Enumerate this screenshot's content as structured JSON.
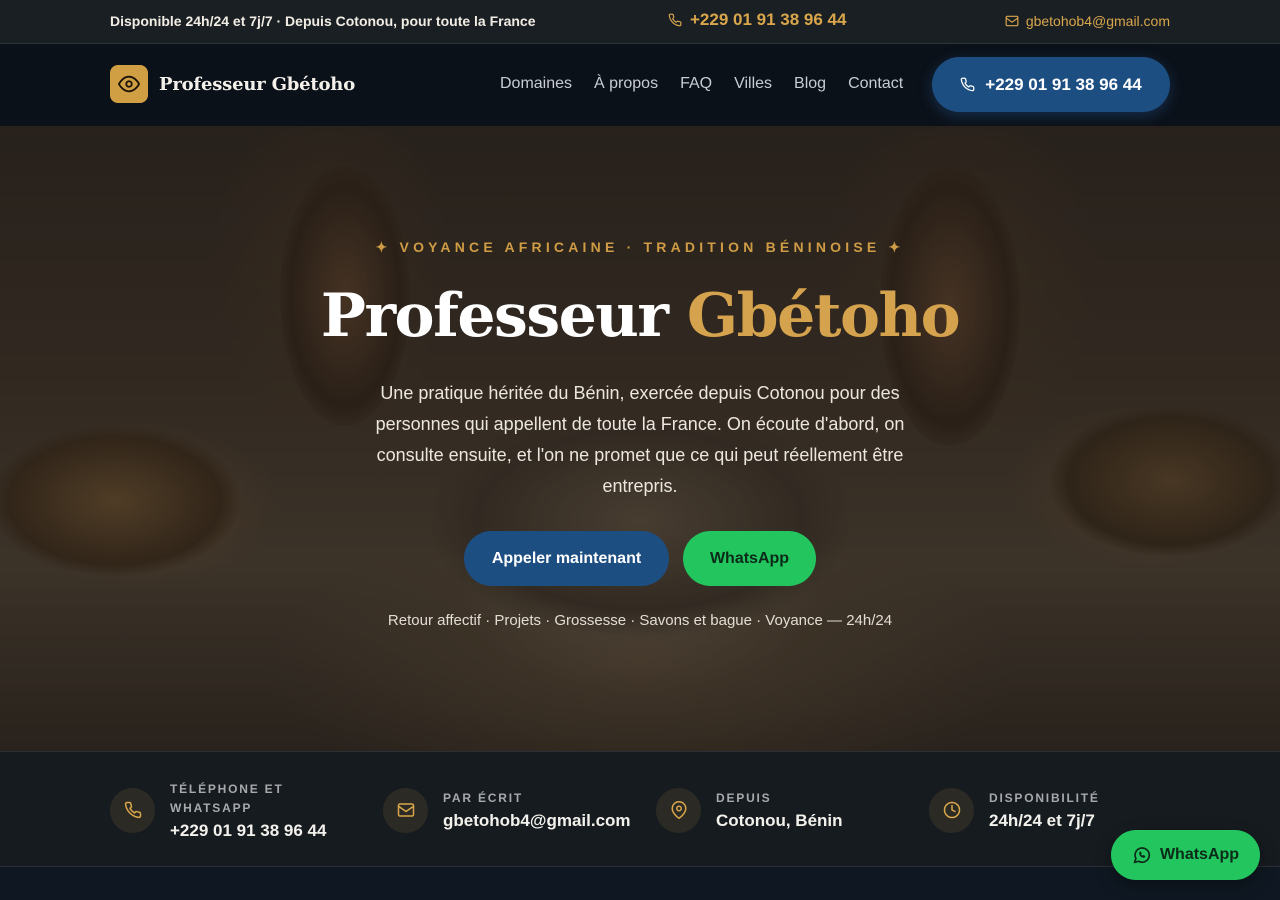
{
  "topbar": {
    "availability": "Disponible 24h/24 et 7j/7 · Depuis Cotonou, pour toute la France",
    "phone": "+229 01 91 38 96 44",
    "email": "gbetohob4@gmail.com"
  },
  "nav": {
    "brand": "Professeur Gbétoho",
    "links": [
      "Domaines",
      "À propos",
      "FAQ",
      "Villes",
      "Blog",
      "Contact"
    ],
    "cta_phone": "+229 01 91 38 96 44"
  },
  "hero": {
    "eyebrow": "✦ VOYANCE AFRICAINE · TRADITION BÉNINOISE ✦",
    "title_white": "Professeur",
    "title_gold": "Gbétoho",
    "description": "Une pratique héritée du Bénin, exercée depuis Cotonou pour des personnes qui appellent de toute la France. On écoute d'abord, on consulte ensuite, et l'on ne promet que ce qui peut réellement être entrepris.",
    "call_button": "Appeler maintenant",
    "whatsapp_button": "WhatsApp",
    "tags": "Retour affectif · Projets · Grossesse · Savons et bague · Voyance — 24h/24"
  },
  "info": [
    {
      "label": "TÉLÉPHONE ET WHATSAPP",
      "value": "+229 01 91 38 96 44",
      "icon": "phone-icon"
    },
    {
      "label": "PAR ÉCRIT",
      "value": "gbetohob4@gmail.com",
      "icon": "mail-icon"
    },
    {
      "label": "DEPUIS",
      "value": "Cotonou, Bénin",
      "icon": "location-pin-icon"
    },
    {
      "label": "DISPONIBILITÉ",
      "value": "24h/24 et 7j/7",
      "icon": "clock-icon"
    }
  ],
  "floating_whatsapp": "WhatsApp",
  "colors": {
    "gold": "#d5a24d",
    "blue": "#1d4e82",
    "green": "#22c55e",
    "dark": "#0b1119"
  }
}
